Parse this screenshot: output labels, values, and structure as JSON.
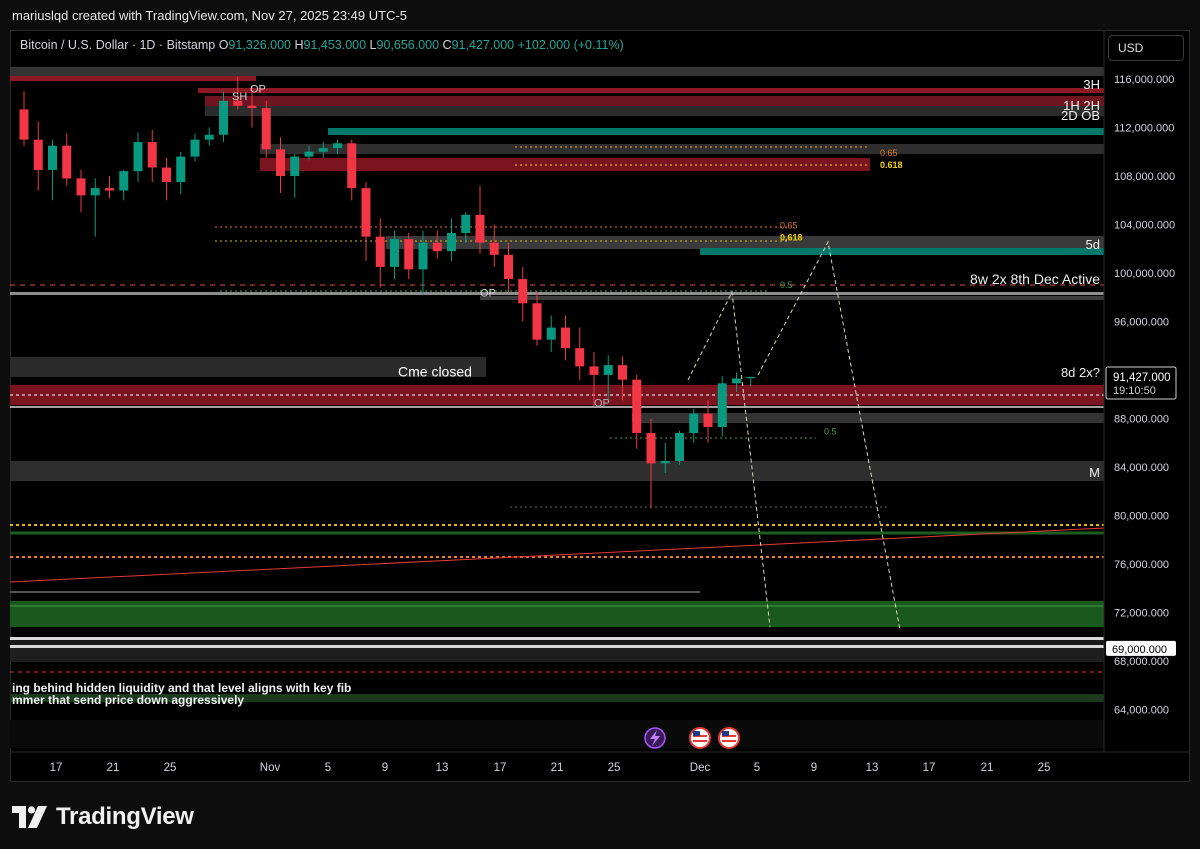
{
  "header": {
    "title": "mariuslqd created with TradingView.com, Nov 27, 2025 23:49 UTC-5"
  },
  "symbol": {
    "name": "Bitcoin / U.S. Dollar · 1D · Bitstamp",
    "open_label": "O",
    "open": "91,326.000",
    "high_label": "H",
    "high": "91,453.000",
    "low_label": "L",
    "low": "90,656.000",
    "close_label": "C",
    "close": "91,427.000",
    "change": "+102.000 (+0.11%)"
  },
  "currency": "USD",
  "last_price": {
    "price": "91,427.000",
    "countdown": "19:10:50"
  },
  "marked_price": "69,000.000",
  "note": {
    "line1": "ing behind hidden liquidity and that level aligns with key fib",
    "line2": "mmer that send price down aggressively"
  },
  "footer": {
    "brand": "TradingView"
  },
  "colors": {
    "up": "#089981",
    "down": "#f23645",
    "teal": "#00897b",
    "zone_red": "#8b1a24",
    "zone_green": "#1b5e20"
  },
  "chart_data": {
    "type": "candlestick",
    "yaxis": {
      "ticks": [
        116000,
        112000,
        108000,
        104000,
        100000,
        96000,
        92000,
        88000,
        84000,
        80000,
        76000,
        72000,
        68000,
        64000
      ]
    },
    "xaxis": {
      "labels": [
        "17",
        "21",
        "25",
        "Nov",
        "5",
        "9",
        "13",
        "17",
        "21",
        "25",
        "Dec",
        "5",
        "9",
        "13",
        "17",
        "21",
        "25"
      ]
    },
    "candles": [
      [
        113500,
        115000,
        110500,
        111000
      ],
      [
        111000,
        112500,
        106800,
        108500
      ],
      [
        108500,
        111000,
        106000,
        110500
      ],
      [
        110500,
        111500,
        107200,
        107800
      ],
      [
        107800,
        108500,
        105000,
        106400
      ],
      [
        106400,
        107800,
        103000,
        107000
      ],
      [
        107000,
        108000,
        106200,
        106800
      ],
      [
        106800,
        108500,
        106000,
        108400
      ],
      [
        108400,
        111600,
        107500,
        110800
      ],
      [
        110800,
        111800,
        107500,
        108700
      ],
      [
        108700,
        109500,
        106000,
        107500
      ],
      [
        107500,
        110000,
        106500,
        109600
      ],
      [
        109600,
        111500,
        109200,
        111000
      ],
      [
        111000,
        112000,
        110500,
        111400
      ],
      [
        111400,
        115000,
        110800,
        114200
      ],
      [
        114200,
        116200,
        113500,
        113800
      ],
      [
        113800,
        115500,
        112000,
        113600
      ],
      [
        113600,
        114200,
        109500,
        110200
      ],
      [
        110200,
        111200,
        106600,
        108000
      ],
      [
        108000,
        109800,
        106200,
        109600
      ],
      [
        109600,
        110500,
        109300,
        110000
      ],
      [
        110000,
        110800,
        109500,
        110300
      ],
      [
        110300,
        111000,
        109800,
        110700
      ],
      [
        110700,
        111000,
        106000,
        107000
      ],
      [
        107000,
        107500,
        101000,
        103000
      ],
      [
        103000,
        104500,
        98800,
        100500
      ],
      [
        100500,
        103500,
        99500,
        102800
      ],
      [
        102800,
        103300,
        99500,
        100300
      ],
      [
        100300,
        103500,
        98200,
        102500
      ],
      [
        102500,
        103500,
        101200,
        101800
      ],
      [
        101800,
        104500,
        101000,
        103300
      ],
      [
        103300,
        105000,
        102500,
        104800
      ],
      [
        104800,
        107200,
        101600,
        102500
      ],
      [
        102500,
        104000,
        100500,
        101500
      ],
      [
        101500,
        102500,
        98400,
        99500
      ],
      [
        99500,
        100500,
        96000,
        97500
      ],
      [
        97500,
        98500,
        94000,
        94500
      ],
      [
        94500,
        96500,
        93500,
        95500
      ],
      [
        95500,
        96500,
        92800,
        93800
      ],
      [
        93800,
        95500,
        91200,
        92300
      ],
      [
        92300,
        93500,
        89000,
        91600
      ],
      [
        91600,
        93200,
        89500,
        92400
      ],
      [
        92400,
        93100,
        89500,
        91200
      ],
      [
        91200,
        91600,
        85500,
        86800
      ],
      [
        86800,
        88000,
        80600,
        84300
      ],
      [
        84300,
        86000,
        83500,
        84500
      ],
      [
        84500,
        87000,
        84200,
        86800
      ],
      [
        86800,
        88800,
        86000,
        88400
      ],
      [
        88400,
        89500,
        86000,
        87300
      ],
      [
        87300,
        91500,
        86500,
        90900
      ],
      [
        90900,
        91800,
        90200,
        91300
      ],
      [
        91326,
        91453,
        90656,
        91427
      ]
    ],
    "zones": [
      {
        "label": "3H",
        "from": 115900,
        "to": 116500,
        "color": "red"
      },
      {
        "label": "1H 2H",
        "from": 113200,
        "to": 114200,
        "color": "red"
      },
      {
        "label": "2D OB",
        "from": 111300,
        "to": 112000,
        "color": "teal"
      },
      {
        "label": "5d",
        "from": 101500,
        "to": 102800,
        "color": "teal"
      },
      {
        "label": "8w 2x 8th Dec Active",
        "from": 97400,
        "to": 98400,
        "color": "grey"
      },
      {
        "label": "8d 2x?",
        "from": 88700,
        "to": 90400,
        "color": "red"
      },
      {
        "label": "M",
        "from": 82400,
        "to": 84200,
        "color": "grey"
      }
    ],
    "annotations": [
      {
        "text": "OP",
        "price": 115200
      },
      {
        "text": "SH",
        "price": 114600
      },
      {
        "text": "0.65",
        "price": 110000
      },
      {
        "text": "0.618",
        "price": 109000
      },
      {
        "text": "0.65",
        "price": 104000
      },
      {
        "text": "0.618",
        "price": 103000
      },
      {
        "text": "0.5",
        "price": 99100
      },
      {
        "text": "OP",
        "price": 98400
      },
      {
        "text": "Cme closed",
        "price": 91800
      },
      {
        "text": "OP",
        "price": 89300
      },
      {
        "text": "0.5",
        "price": 87000
      }
    ]
  }
}
